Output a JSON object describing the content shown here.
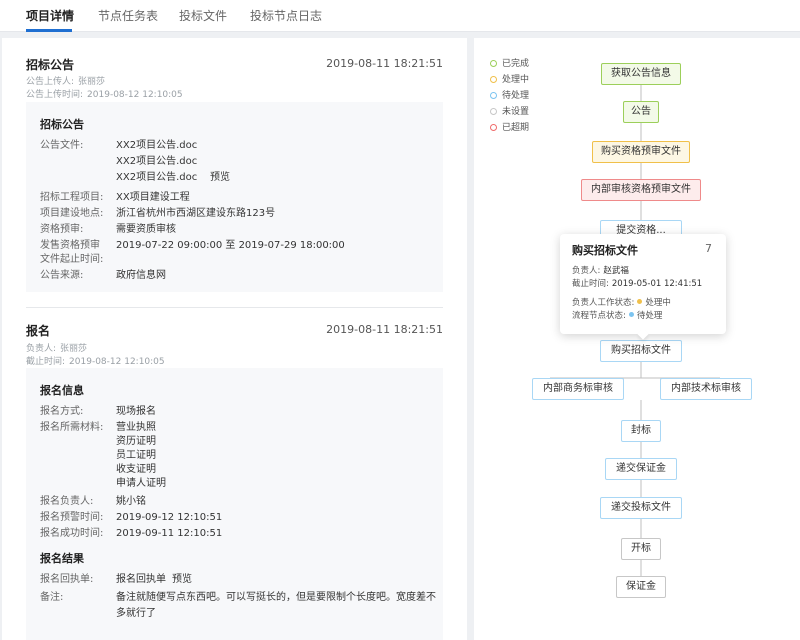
{
  "tabs": [
    "项目详情",
    "节点任务表",
    "投标文件",
    "投标节点日志"
  ],
  "announcement": {
    "title": "招标公告",
    "time": "2019-08-11 18:21:51",
    "uploader_label": "公告上传人:",
    "uploader": "张丽莎",
    "upload_time_label": "公告上传时间:",
    "upload_time": "2019-08-12 12:10:05",
    "box_title": "招标公告",
    "file_label": "公告文件:",
    "files": [
      "XX2项目公告.doc",
      "XX2项目公告.doc",
      "XX2项目公告.doc"
    ],
    "preview": "预览",
    "fields": [
      {
        "k": "招标工程项目:",
        "v": "XX项目建设工程"
      },
      {
        "k": "项目建设地点:",
        "v": "浙江省杭州市西湖区建设东路123号"
      },
      {
        "k": "资格预审:",
        "v": "需要资质审核"
      },
      {
        "k": "发售资格预审",
        "v": "2019-07-22 09:00:00 至 2019-07-29 18:00:00"
      },
      {
        "k": "文件起止时间:",
        "v": ""
      },
      {
        "k": "公告来源:",
        "v": "政府信息网"
      }
    ]
  },
  "signup": {
    "title": "报名",
    "time": "2019-08-11 18:21:51",
    "owner_label": "负责人:",
    "owner": "张丽莎",
    "deadline_label": "截止时间:",
    "deadline": "2019-08-12 12:10:05",
    "info_title": "报名信息",
    "method_label": "报名方式:",
    "method": "现场报名",
    "materials_label": "报名所需材料:",
    "materials": [
      "营业执照",
      "资历证明",
      "员工证明",
      "收支证明",
      "申请人证明"
    ],
    "person_label": "报名负责人:",
    "person": "姚小铭",
    "warn_label": "报名预警时间:",
    "warn_time": "2019-09-12 12:10:51",
    "success_label": "报名成功时间:",
    "success_time": "2019-09-11 12:10:51",
    "result_title": "报名结果",
    "receipt_label": "报名回执单:",
    "receipt": "报名回执单",
    "preview": "预览",
    "note_label": "备注:",
    "note_line1": "备注就随便写点东西吧。可以写挺长的，但是要限制个长度吧。宽度差不",
    "note_line2": "多就行了"
  },
  "legend": [
    {
      "label": "已完成",
      "color": "#9ccf5a"
    },
    {
      "label": "处理中",
      "color": "#f0c04a"
    },
    {
      "label": "待处理",
      "color": "#7cc4f0"
    },
    {
      "label": "未设置",
      "color": "#c7c7c7"
    },
    {
      "label": "已超期",
      "color": "#ef6b6b"
    }
  ],
  "flow": {
    "n1": "获取公告信息",
    "n2": "公告",
    "n3": "购买资格预审文件",
    "n4": "内部审核资格预审文件",
    "n5": "提交资格...",
    "n6": "购买招标文件",
    "n7": "内部商务标审核",
    "n8": "内部技术标审核",
    "n9": "封标",
    "n10": "递交保证金",
    "n11": "递交投标文件",
    "n12": "开标",
    "n13": "保证金"
  },
  "popover": {
    "title": "购买招标文件",
    "num": "7",
    "owner_label": "负责人:",
    "owner": "赵武福",
    "deadline_label": "截止时间:",
    "deadline": "2019-05-01 12:41:51",
    "work_label": "负责人工作状态:",
    "work_status": "处理中",
    "work_color": "#f0c04a",
    "flow_label": "流程节点状态:",
    "flow_status": "待处理",
    "flow_color": "#7cc4f0"
  }
}
